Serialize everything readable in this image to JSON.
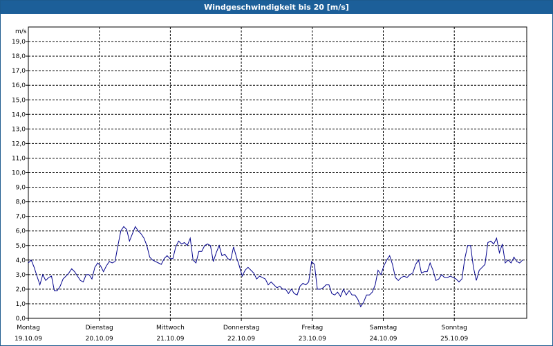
{
  "window": {
    "title": "Windgeschwindigkeit bis 20 [m/s]"
  },
  "chart_data": {
    "type": "line",
    "title": "Windgeschwindigkeit bis 20 [m/s]",
    "ylabel": "m/s",
    "ylim": [
      0,
      20
    ],
    "yticks": [
      "0,0",
      "1,0",
      "2,0",
      "3,0",
      "4,0",
      "5,0",
      "6,0",
      "7,0",
      "8,0",
      "9,0",
      "10,0",
      "11,0",
      "12,0",
      "13,0",
      "14,0",
      "15,0",
      "16,0",
      "17,0",
      "18,0",
      "19,0"
    ],
    "xlim": [
      0,
      7
    ],
    "xticks": [
      {
        "day": "Montag",
        "date": "19.10.09"
      },
      {
        "day": "Dienstag",
        "date": "20.10.09"
      },
      {
        "day": "Mittwoch",
        "date": "21.10.09"
      },
      {
        "day": "Donnerstag",
        "date": "22.10.09"
      },
      {
        "day": "Freitag",
        "date": "23.10.09"
      },
      {
        "day": "Samstag",
        "date": "24.10.09"
      },
      {
        "day": "Sonntag",
        "date": "25.10.09"
      }
    ],
    "grid": true,
    "color": "#00008b",
    "series": [
      {
        "values": [
          3.8,
          4.0,
          3.5,
          2.9,
          2.3,
          3.0,
          2.6,
          2.8,
          2.9,
          1.9,
          1.9,
          2.2,
          2.7,
          2.9,
          3.1,
          3.4,
          3.2,
          2.9,
          2.6,
          2.5,
          3.0,
          3.0,
          2.7,
          3.5,
          3.8,
          3.6,
          3.2,
          3.6,
          3.9,
          3.8,
          3.9,
          5.0,
          6.0,
          6.3,
          6.1,
          5.3,
          5.8,
          6.3,
          6.0,
          5.8,
          5.5,
          5.0,
          4.2,
          4.0,
          3.9,
          3.8,
          3.7,
          4.1,
          4.3,
          4.1,
          4.1,
          4.9,
          5.3,
          5.1,
          5.2,
          5.0,
          5.5,
          4.0,
          3.8,
          4.6,
          4.6,
          5.0,
          5.1,
          5.0,
          3.9,
          4.5,
          5.0,
          4.3,
          4.4,
          4.1,
          4.0,
          4.9,
          4.2,
          3.6,
          2.9,
          3.3,
          3.5,
          3.3,
          3.1,
          2.7,
          2.9,
          2.8,
          2.7,
          2.3,
          2.5,
          2.3,
          2.1,
          2.2,
          2.0,
          2.0,
          1.7,
          2.0,
          1.7,
          1.6,
          2.2,
          2.4,
          2.3,
          2.5,
          3.9,
          3.7,
          2.0,
          2.0,
          2.1,
          2.3,
          2.3,
          1.7,
          1.6,
          1.8,
          1.5,
          2.0,
          1.6,
          1.9,
          1.6,
          1.6,
          1.3,
          0.8,
          1.1,
          1.6,
          1.6,
          1.8,
          2.3,
          3.3,
          3.0,
          3.6,
          4.0,
          4.3,
          3.7,
          2.8,
          2.6,
          2.8,
          2.9,
          2.8,
          3.0,
          3.1,
          3.7,
          4.0,
          3.1,
          3.2,
          3.2,
          3.8,
          3.3,
          2.6,
          2.7,
          3.0,
          2.8,
          2.8,
          2.9,
          2.8,
          2.7,
          2.5,
          2.7,
          4.1,
          5.0,
          5.0,
          3.5,
          2.6,
          3.3,
          3.5,
          3.7,
          5.2,
          5.3,
          5.1,
          5.5,
          4.5,
          5.1,
          3.8,
          4.0,
          3.8,
          4.2,
          3.9,
          3.8,
          4.0
        ]
      }
    ]
  }
}
